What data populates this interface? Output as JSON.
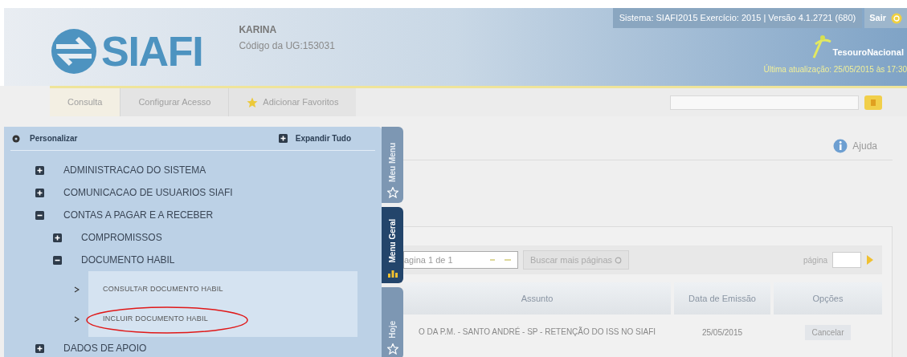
{
  "header": {
    "logo": "SIAFI",
    "user_name": "KARINA",
    "ug_code": "Código da UG:153031",
    "system_info": "Sistema: SIAFI2015 Exercício: 2015 | Versão 4.1.2721 (680)",
    "logout": "Sair",
    "brand": "TesouroNacional",
    "last_update": "Última atualização: 25/05/2015 às 17:30"
  },
  "toolbar": [
    {
      "label": "Consulta",
      "kind": "tab",
      "selected": true
    },
    {
      "label": "Configurar Acesso",
      "kind": "tab",
      "selected": false
    },
    {
      "label": "Adicionar Favoritos",
      "kind": "favorite",
      "selected": false
    }
  ],
  "help": "Ajuda",
  "menu": {
    "personalize": "Personalizar",
    "expand_all": "Expandir Tudo",
    "items": [
      {
        "label": "ADMINISTRACAO DO SISTEMA",
        "expanded": false
      },
      {
        "label": "COMUNICACAO DE USUARIOS SIAFI",
        "expanded": false
      },
      {
        "label": "CONTAS A PAGAR E A RECEBER",
        "expanded": true,
        "children": [
          {
            "label": "COMPROMISSOS",
            "expanded": false
          },
          {
            "label": "DOCUMENTO HABIL",
            "expanded": true,
            "children": [
              {
                "label": "CONSULTAR DOCUMENTO HABIL",
                "kind": "leaf",
                "circled": false
              },
              {
                "label": "INCLUIR DOCUMENTO HABIL",
                "kind": "leaf",
                "circled": true
              }
            ]
          }
        ]
      },
      {
        "label": "DADOS DE APOIO",
        "expanded": false
      }
    ]
  },
  "side_tabs": [
    {
      "label": "Meu Menu",
      "selected": false
    },
    {
      "label": "Menu Geral",
      "selected": true
    },
    {
      "label": "Hoje",
      "selected": false
    }
  ],
  "pagination": {
    "page_select": "agina 1 de 1",
    "more_button": "Buscar mais páginas",
    "page_label": "página"
  },
  "table": {
    "columns": [
      "Assunto",
      "Data de Emissão",
      "Opções"
    ],
    "rows": [
      {
        "subject": "O DA P.M. - SANTO ANDRÉ - SP - RETENÇÃO DO ISS NO SIAFI",
        "date": "25/05/2015",
        "action": "Cancelar"
      }
    ]
  }
}
